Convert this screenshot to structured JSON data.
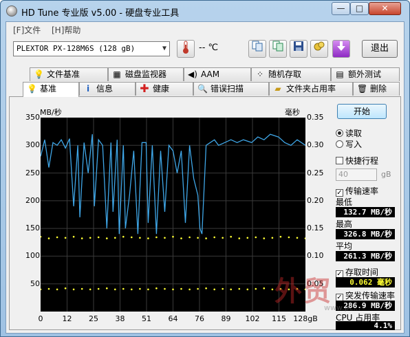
{
  "window": {
    "title": "HD Tune 专业版 v5.00 - 硬盘专业工具",
    "min_label": "—",
    "max_label": "□",
    "close_label": "✕"
  },
  "menu": {
    "file": "[F]文件",
    "help": "[H]帮助"
  },
  "toolbar": {
    "drive": "PLEXTOR PX-128M6S (128 gB)",
    "temperature": "-- ℃",
    "exit_label": "退出",
    "icons": [
      "thermometer-icon",
      "info-icon",
      "copy-icon",
      "save-icon",
      "clean-icon",
      "download-icon"
    ]
  },
  "tabs_top": [
    {
      "label": "文件基准",
      "icon": "file-benchmark-icon"
    },
    {
      "label": "磁盘监视器",
      "icon": "disk-monitor-icon"
    },
    {
      "label": "AAM",
      "icon": "speaker-icon"
    },
    {
      "label": "随机存取",
      "icon": "random-access-icon"
    },
    {
      "label": "额外测试",
      "icon": "extra-tests-icon"
    }
  ],
  "tabs_bottom": [
    {
      "label": "基准",
      "icon": "benchmark-icon"
    },
    {
      "label": "信息",
      "icon": "info-icon"
    },
    {
      "label": "健康",
      "icon": "health-cross-icon"
    },
    {
      "label": "错误扫描",
      "icon": "error-scan-icon"
    },
    {
      "label": "文件夹占用率",
      "icon": "folder-icon"
    },
    {
      "label": "删除",
      "icon": "trash-icon"
    }
  ],
  "side": {
    "start_label": "开始",
    "read_label": "读取",
    "write_label": "写入",
    "quick_stroke_label": "快捷行程",
    "quick_stroke_value": "40",
    "quick_stroke_unit": "gB",
    "transfer_rate_label": "传输速率",
    "min_label": "最低",
    "min_value": "132.7 MB/秒",
    "max_label": "最高",
    "max_value": "326.8 MB/秒",
    "avg_label": "平均",
    "avg_value": "261.3 MB/秒",
    "access_time_label": "存取时间",
    "access_time_value": "0.062 毫秒",
    "burst_label": "突发传输速率",
    "burst_value": "286.9 MB/秒",
    "cpu_label": "CPU 占用率",
    "cpu_value": "4.1%"
  },
  "watermark": {
    "text": "外贸",
    "sub": "www.pc..."
  },
  "chart_data": {
    "type": "line",
    "ylabel_left": "MB/秒",
    "ylabel_right": "毫秒",
    "yticks_left": [
      "350",
      "300",
      "250",
      "200",
      "150",
      "100",
      "50"
    ],
    "yticks_right": [
      "0.35",
      "0.30",
      "0.25",
      "0.20",
      "0.15",
      "0.10",
      "0.05"
    ],
    "xticks": [
      "0",
      "12",
      "25",
      "38",
      "51",
      "64",
      "76",
      "89",
      "102",
      "115",
      "128gB"
    ],
    "xlim": [
      0,
      128
    ],
    "ylim_left": [
      0,
      350
    ],
    "ylim_right": [
      0,
      0.35
    ],
    "grid": true,
    "background": "#000000",
    "series": [
      {
        "color": "#3fa7e8",
        "axis": "left",
        "x": [
          0,
          2,
          4,
          6,
          8,
          10,
          12,
          14,
          16,
          18,
          19,
          21,
          23,
          25,
          26,
          28,
          30,
          32,
          34,
          35,
          37,
          38,
          40,
          41,
          43,
          45,
          47,
          49,
          51,
          52,
          54,
          56,
          58,
          60,
          62,
          64,
          66,
          68,
          70,
          72,
          74,
          76,
          77,
          78,
          80,
          82,
          84,
          86,
          89,
          92,
          95,
          98,
          102,
          105,
          108,
          111,
          115,
          118,
          121,
          124,
          128
        ],
        "values": [
          280,
          310,
          260,
          305,
          300,
          310,
          295,
          312,
          190,
          300,
          170,
          305,
          250,
          320,
          190,
          310,
          300,
          150,
          305,
          180,
          310,
          140,
          300,
          150,
          210,
          290,
          140,
          305,
          305,
          160,
          300,
          140,
          290,
          180,
          300,
          290,
          250,
          290,
          160,
          300,
          240,
          210,
          150,
          140,
          300,
          305,
          310,
          300,
          305,
          310,
          305,
          310,
          305,
          315,
          310,
          320,
          315,
          305,
          300,
          310,
          300
        ]
      },
      {
        "color": "#ffff33",
        "axis": "right",
        "x": [
          0,
          4,
          8,
          12,
          16,
          20,
          24,
          28,
          32,
          36,
          40,
          44,
          48,
          52,
          56,
          60,
          64,
          68,
          72,
          76,
          80,
          84,
          88,
          92,
          96,
          100,
          104,
          108,
          112,
          116,
          120,
          124,
          128
        ],
        "values": [
          0.135,
          0.132,
          0.134,
          0.133,
          0.135,
          0.132,
          0.133,
          0.134,
          0.132,
          0.133,
          0.135,
          0.134,
          0.133,
          0.132,
          0.134,
          0.133,
          0.135,
          0.132,
          0.134,
          0.133,
          0.132,
          0.134,
          0.133,
          0.135,
          0.132,
          0.133,
          0.134,
          0.132,
          0.133,
          0.135,
          0.134,
          0.133,
          0.132
        ]
      },
      {
        "color": "#ffff33",
        "axis": "right",
        "x": [
          0,
          4,
          8,
          12,
          16,
          20,
          24,
          28,
          32,
          36,
          40,
          44,
          48,
          52,
          56,
          60,
          64,
          68,
          72,
          76,
          80,
          84,
          88,
          92,
          96,
          100,
          104,
          108,
          112,
          116,
          120,
          124,
          128
        ],
        "values": [
          0.04,
          0.041,
          0.04,
          0.042,
          0.04,
          0.041,
          0.04,
          0.041,
          0.042,
          0.04,
          0.041,
          0.04,
          0.041,
          0.04,
          0.042,
          0.041,
          0.04,
          0.041,
          0.04,
          0.041,
          0.042,
          0.04,
          0.041,
          0.04,
          0.041,
          0.04,
          0.041,
          0.042,
          0.04,
          0.041,
          0.04,
          0.041,
          0.04
        ]
      }
    ]
  }
}
